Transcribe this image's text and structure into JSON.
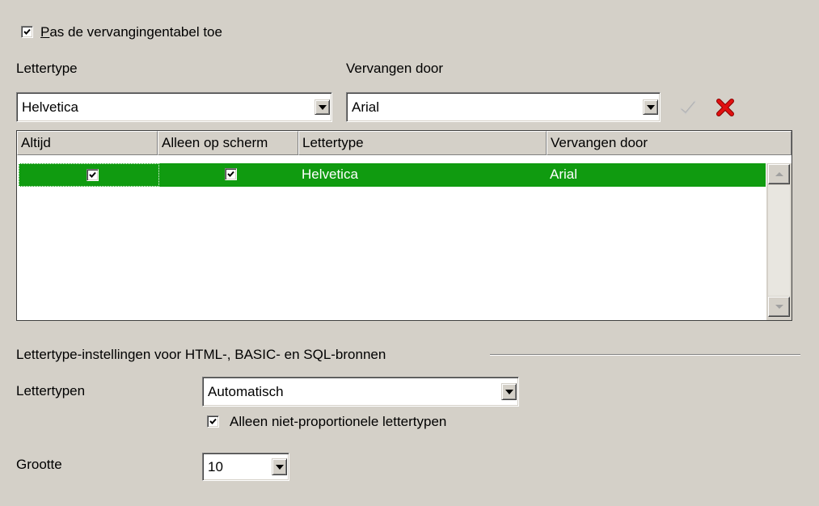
{
  "apply_table": {
    "label": "Pas de vervangingentabel toe",
    "checked": true
  },
  "font_label": "Lettertype",
  "replace_label": "Vervangen door",
  "font_combo": {
    "value": "Helvetica"
  },
  "replace_combo": {
    "value": "Arial"
  },
  "icons": {
    "apply": "checkmark-icon",
    "delete": "delete-x-icon"
  },
  "table": {
    "headers": [
      "Altijd",
      "Alleen op scherm",
      "Lettertype",
      "Vervangen door"
    ],
    "rows": [
      {
        "always": true,
        "screen_only": true,
        "font": "Helvetica",
        "replace": "Arial"
      }
    ]
  },
  "source_section": {
    "title": "Lettertype-instellingen voor HTML-, BASIC- en SQL-bronnen",
    "fonts_label": "Lettertypen",
    "fonts_value": "Automatisch",
    "nonprop_label": "Alleen niet-proportionele lettertypen",
    "nonprop_checked": true,
    "size_label": "Grootte",
    "size_value": "10"
  },
  "colors": {
    "selection": "#109b10",
    "background": "#d4d0c8",
    "delete": "#e01010"
  }
}
